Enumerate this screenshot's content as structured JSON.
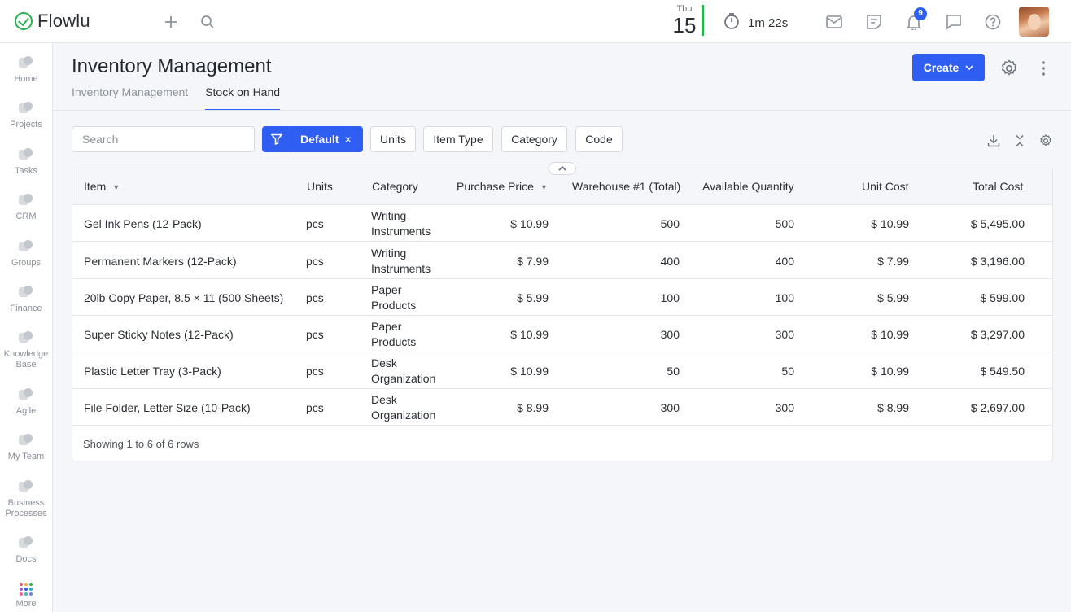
{
  "app": {
    "name": "Flowlu",
    "brand_color": "#27b14f",
    "accent_color": "#2f5ef2"
  },
  "topbar": {
    "add_icon": "plus-icon",
    "search_icon": "search-icon",
    "date": {
      "dow": "Thu",
      "day": "15"
    },
    "timer": {
      "icon": "stopwatch-icon",
      "value": "1m 22s"
    },
    "icons": [
      "mail-icon",
      "notes-icon",
      "bell-icon",
      "chat-icon",
      "help-icon"
    ],
    "notification_count": "9"
  },
  "sidebar": {
    "items": [
      {
        "label": "Home",
        "icon": "home-icon"
      },
      {
        "label": "Projects",
        "icon": "projects-icon"
      },
      {
        "label": "Tasks",
        "icon": "tasks-icon"
      },
      {
        "label": "CRM",
        "icon": "crm-icon"
      },
      {
        "label": "Groups",
        "icon": "groups-icon"
      },
      {
        "label": "Finance",
        "icon": "finance-icon"
      },
      {
        "label": "Knowledge Base",
        "icon": "knowledge-base-icon"
      },
      {
        "label": "Agile",
        "icon": "agile-icon"
      },
      {
        "label": "My Team",
        "icon": "team-icon"
      },
      {
        "label": "Business Processes",
        "icon": "business-processes-icon"
      },
      {
        "label": "Docs",
        "icon": "docs-icon"
      },
      {
        "label": "More",
        "icon": "grid-dots-icon"
      }
    ]
  },
  "header": {
    "title": "Inventory Management",
    "tabs": [
      {
        "label": "Inventory Management",
        "active": false
      },
      {
        "label": "Stock on Hand",
        "active": true
      }
    ],
    "create_label": "Create"
  },
  "toolbar": {
    "search_placeholder": "Search",
    "filter_label": "Default",
    "filter_close": "×",
    "chips": [
      "Units",
      "Item Type",
      "Category",
      "Code"
    ]
  },
  "table": {
    "columns": [
      "Item",
      "Units",
      "Category",
      "Purchase Price",
      "Warehouse #1 (Total)",
      "Available Quantity",
      "Unit Cost",
      "Total Cost"
    ],
    "rows": [
      {
        "item": "Gel Ink Pens (12-Pack)",
        "units": "pcs",
        "category_1": "Writing",
        "category_2": "Instruments",
        "purchase_price": "$ 10.99",
        "warehouse": "500",
        "available": "500",
        "unit_cost": "$ 10.99",
        "total_cost": "$ 5,495.00"
      },
      {
        "item": "Permanent Markers (12-Pack)",
        "units": "pcs",
        "category_1": "Writing",
        "category_2": "Instruments",
        "purchase_price": "$ 7.99",
        "warehouse": "400",
        "available": "400",
        "unit_cost": "$ 7.99",
        "total_cost": "$ 3,196.00"
      },
      {
        "item": "20lb Copy Paper, 8.5 × 11 (500 Sheets)",
        "units": "pcs",
        "category_1": "Paper",
        "category_2": "Products",
        "purchase_price": "$ 5.99",
        "warehouse": "100",
        "available": "100",
        "unit_cost": "$ 5.99",
        "total_cost": "$ 599.00"
      },
      {
        "item": "Super Sticky Notes (12-Pack)",
        "units": "pcs",
        "category_1": "Paper",
        "category_2": "Products",
        "purchase_price": "$ 10.99",
        "warehouse": "300",
        "available": "300",
        "unit_cost": "$ 10.99",
        "total_cost": "$ 3,297.00"
      },
      {
        "item": "Plastic Letter Tray (3-Pack)",
        "units": "pcs",
        "category_1": "Desk",
        "category_2": "Organization",
        "purchase_price": "$ 10.99",
        "warehouse": "50",
        "available": "50",
        "unit_cost": "$ 10.99",
        "total_cost": "$ 549.50"
      },
      {
        "item": "File Folder, Letter Size (10-Pack)",
        "units": "pcs",
        "category_1": "Desk",
        "category_2": "Organization",
        "purchase_price": "$ 8.99",
        "warehouse": "300",
        "available": "300",
        "unit_cost": "$ 8.99",
        "total_cost": "$ 2,697.00"
      }
    ],
    "footer": "Showing 1 to 6 of 6 rows"
  }
}
